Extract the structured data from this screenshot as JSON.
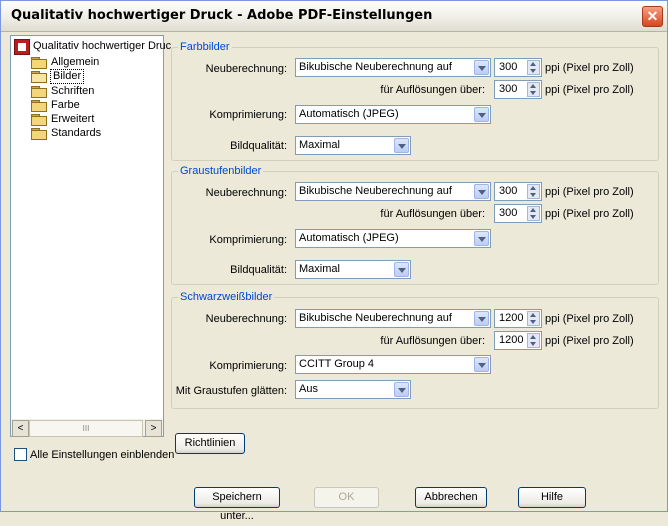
{
  "window": {
    "title": "Qualitativ hochwertiger Druck - Adobe PDF-Einstellungen",
    "close_glyph": "✕"
  },
  "tree": {
    "root": "Qualitativ hochwertiger Druc",
    "items": [
      "Allgemein",
      "Bilder",
      "Schriften",
      "Farbe",
      "Erweitert",
      "Standards"
    ],
    "selected": "Bilder"
  },
  "scrollbar": {
    "left": "<",
    "right": ">",
    "thumb": "III"
  },
  "farbbilder": {
    "legend": "Farbbilder",
    "resample_label": "Neuberechnung:",
    "resample_value": "Bikubische Neuberechnung auf",
    "ppi_value": "300",
    "ppi_unit": "ppi (Pixel pro Zoll)",
    "above_label": "für Auflösungen über:",
    "above_value": "300",
    "above_unit": "ppi (Pixel pro Zoll)",
    "compress_label": "Komprimierung:",
    "compress_value": "Automatisch (JPEG)",
    "quality_label": "Bildqualität:",
    "quality_value": "Maximal"
  },
  "graustufen": {
    "legend": "Graustufenbilder",
    "resample_label": "Neuberechnung:",
    "resample_value": "Bikubische Neuberechnung auf",
    "ppi_value": "300",
    "ppi_unit": "ppi (Pixel pro Zoll)",
    "above_label": "für Auflösungen über:",
    "above_value": "300",
    "above_unit": "ppi (Pixel pro Zoll)",
    "compress_label": "Komprimierung:",
    "compress_value": "Automatisch (JPEG)",
    "quality_label": "Bildqualität:",
    "quality_value": "Maximal"
  },
  "schwarzweiss": {
    "legend": "Schwarzweißbilder",
    "resample_label": "Neuberechnung:",
    "resample_value": "Bikubische Neuberechnung auf",
    "ppi_value": "1200",
    "ppi_unit": "ppi (Pixel pro Zoll)",
    "above_label": "für Auflösungen über:",
    "above_value": "1200",
    "above_unit": "ppi (Pixel pro Zoll)",
    "compress_label": "Komprimierung:",
    "compress_value": "CCITT Group 4",
    "smooth_label": "Mit Graustufen glätten:",
    "smooth_value": "Aus"
  },
  "buttons": {
    "guidelines": "Richtlinien",
    "save_as": "Speichern unter...",
    "ok": "OK",
    "cancel": "Abbrechen",
    "help": "Hilfe"
  },
  "show_all": {
    "label": "Alle Einstellungen einblenden",
    "checked": false
  }
}
